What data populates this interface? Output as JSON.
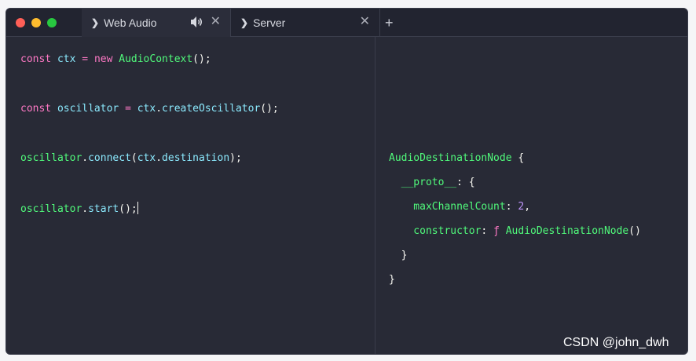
{
  "window": {
    "traffic_lights": {
      "close_color": "#ff5f57",
      "minimize_color": "#febc2e",
      "maximize_color": "#28c840"
    },
    "tabs": [
      {
        "label": "Web Audio",
        "chevron_icon": "chevron-right-icon",
        "audio_icon": "speaker-icon",
        "close_icon": "close-icon",
        "active": true
      },
      {
        "label": "Server",
        "chevron_icon": "chevron-right-icon",
        "close_icon": "close-icon",
        "active": false
      }
    ],
    "new_tab_label": "+"
  },
  "editor": {
    "lines": [
      {
        "tokens": [
          {
            "t": "const ",
            "c": "kw"
          },
          {
            "t": "ctx",
            "c": "var"
          },
          {
            "t": " = ",
            "c": "kw"
          },
          {
            "t": "new ",
            "c": "kw"
          },
          {
            "t": "AudioContext",
            "c": "fn"
          },
          {
            "t": "();",
            "c": "pun"
          }
        ]
      },
      {
        "tokens": [
          {
            "t": "const ",
            "c": "kw"
          },
          {
            "t": "oscillator",
            "c": "var"
          },
          {
            "t": " = ",
            "c": "kw"
          },
          {
            "t": "ctx",
            "c": "var"
          },
          {
            "t": ".",
            "c": "pun"
          },
          {
            "t": "createOscillator",
            "c": "var"
          },
          {
            "t": "();",
            "c": "pun"
          }
        ]
      },
      {
        "tokens": [
          {
            "t": "oscillator",
            "c": "id"
          },
          {
            "t": ".",
            "c": "pun"
          },
          {
            "t": "connect",
            "c": "var"
          },
          {
            "t": "(",
            "c": "pun"
          },
          {
            "t": "ctx",
            "c": "var"
          },
          {
            "t": ".",
            "c": "pun"
          },
          {
            "t": "destination",
            "c": "var"
          },
          {
            "t": ");",
            "c": "pun"
          }
        ]
      },
      {
        "tokens": [
          {
            "t": "oscillator",
            "c": "id"
          },
          {
            "t": ".",
            "c": "pun"
          },
          {
            "t": "start",
            "c": "var"
          },
          {
            "t": "();",
            "c": "pun"
          }
        ],
        "cursor": true
      }
    ]
  },
  "output": {
    "lines": [
      {
        "tokens": [
          {
            "t": "AudioDestinationNode",
            "c": "fn"
          },
          {
            "t": " {",
            "c": "pun"
          }
        ]
      },
      {
        "tokens": [
          {
            "t": "  __proto__",
            "c": "id"
          },
          {
            "t": ": {",
            "c": "pun"
          }
        ]
      },
      {
        "tokens": [
          {
            "t": "    maxChannelCount",
            "c": "id"
          },
          {
            "t": ": ",
            "c": "pun"
          },
          {
            "t": "2",
            "c": "num"
          },
          {
            "t": ",",
            "c": "pun"
          }
        ]
      },
      {
        "tokens": [
          {
            "t": "    constructor",
            "c": "id"
          },
          {
            "t": ": ",
            "c": "pun"
          },
          {
            "t": "ƒ ",
            "c": "kw"
          },
          {
            "t": "AudioDestinationNode",
            "c": "fn"
          },
          {
            "t": "()",
            "c": "pun"
          }
        ]
      },
      {
        "tokens": [
          {
            "t": "  }",
            "c": "pun"
          }
        ]
      },
      {
        "tokens": [
          {
            "t": "}",
            "c": "pun"
          }
        ]
      }
    ]
  },
  "watermark": "CSDN @john_dwh"
}
